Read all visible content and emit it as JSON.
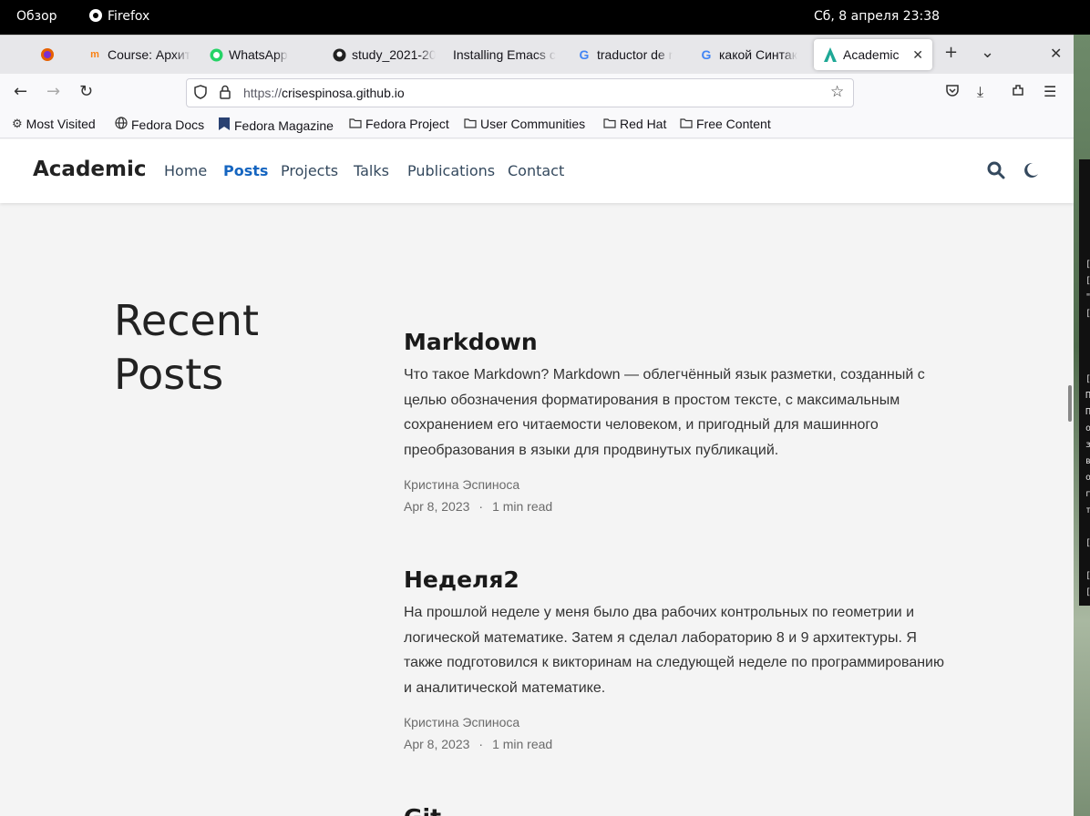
{
  "system": {
    "activities": "Обзор",
    "app_name": "Firefox",
    "clock": "Сб, 8 апреля  23:38"
  },
  "tabs": [
    {
      "label": "",
      "icon": "firefox-icon"
    },
    {
      "label": "Course: Архит",
      "icon": "moodle-icon"
    },
    {
      "label": "WhatsApp",
      "icon": "whatsapp-icon"
    },
    {
      "label": "study_2021-20",
      "icon": "github-icon"
    },
    {
      "label": "Installing Emacs c",
      "icon": "page-icon"
    },
    {
      "label": "traductor de r",
      "icon": "google-icon"
    },
    {
      "label": "какой Синтак",
      "icon": "google-icon"
    },
    {
      "label": "Academic",
      "icon": "academic-icon",
      "active": true
    }
  ],
  "url": {
    "prefix": "https://",
    "host": "crisespinosa.github.io"
  },
  "bookmarks": [
    {
      "label": "Most Visited",
      "icon": "gear-icon"
    },
    {
      "label": "Fedora Docs",
      "icon": "globe-icon"
    },
    {
      "label": "Fedora Magazine",
      "icon": "fm-icon"
    },
    {
      "label": "Fedora Project",
      "icon": "folder-icon"
    },
    {
      "label": "User Communities",
      "icon": "folder-icon"
    },
    {
      "label": "Red Hat",
      "icon": "folder-icon"
    },
    {
      "label": "Free Content",
      "icon": "folder-icon"
    }
  ],
  "site": {
    "brand": "Academic",
    "nav": [
      "Home",
      "Posts",
      "Projects",
      "Talks",
      "Publications",
      "Contact"
    ],
    "active_nav": "Posts"
  },
  "heading_line1": "Recent",
  "heading_line2": "Posts",
  "posts": [
    {
      "title": "Markdown",
      "summary": "Что такое Markdown? Markdown — облегчённый язык разметки, созданный с целью обозначения форматирования в простом тексте, с максимальным сохранением его читаемости человеком, и пригодный для машинного преобразования в языки для продвинутых публикаций.",
      "author": "Кристина Эспиноса",
      "date": "Apr 8, 2023",
      "read": "1 min read"
    },
    {
      "title": "Неделя2",
      "summary": "На прошлой неделе у меня было два рабочих контрольных по геометрии и логической математике. Затем я сделал лабораторию 8 и 9 архитектуры. Я также подготовился к викторинам на следующей неделе по программированию и аналитической математике.",
      "author": "Кристина Эспиноса",
      "date": "Apr 8, 2023",
      "read": "1 min read"
    },
    {
      "title": "Git"
    }
  ]
}
